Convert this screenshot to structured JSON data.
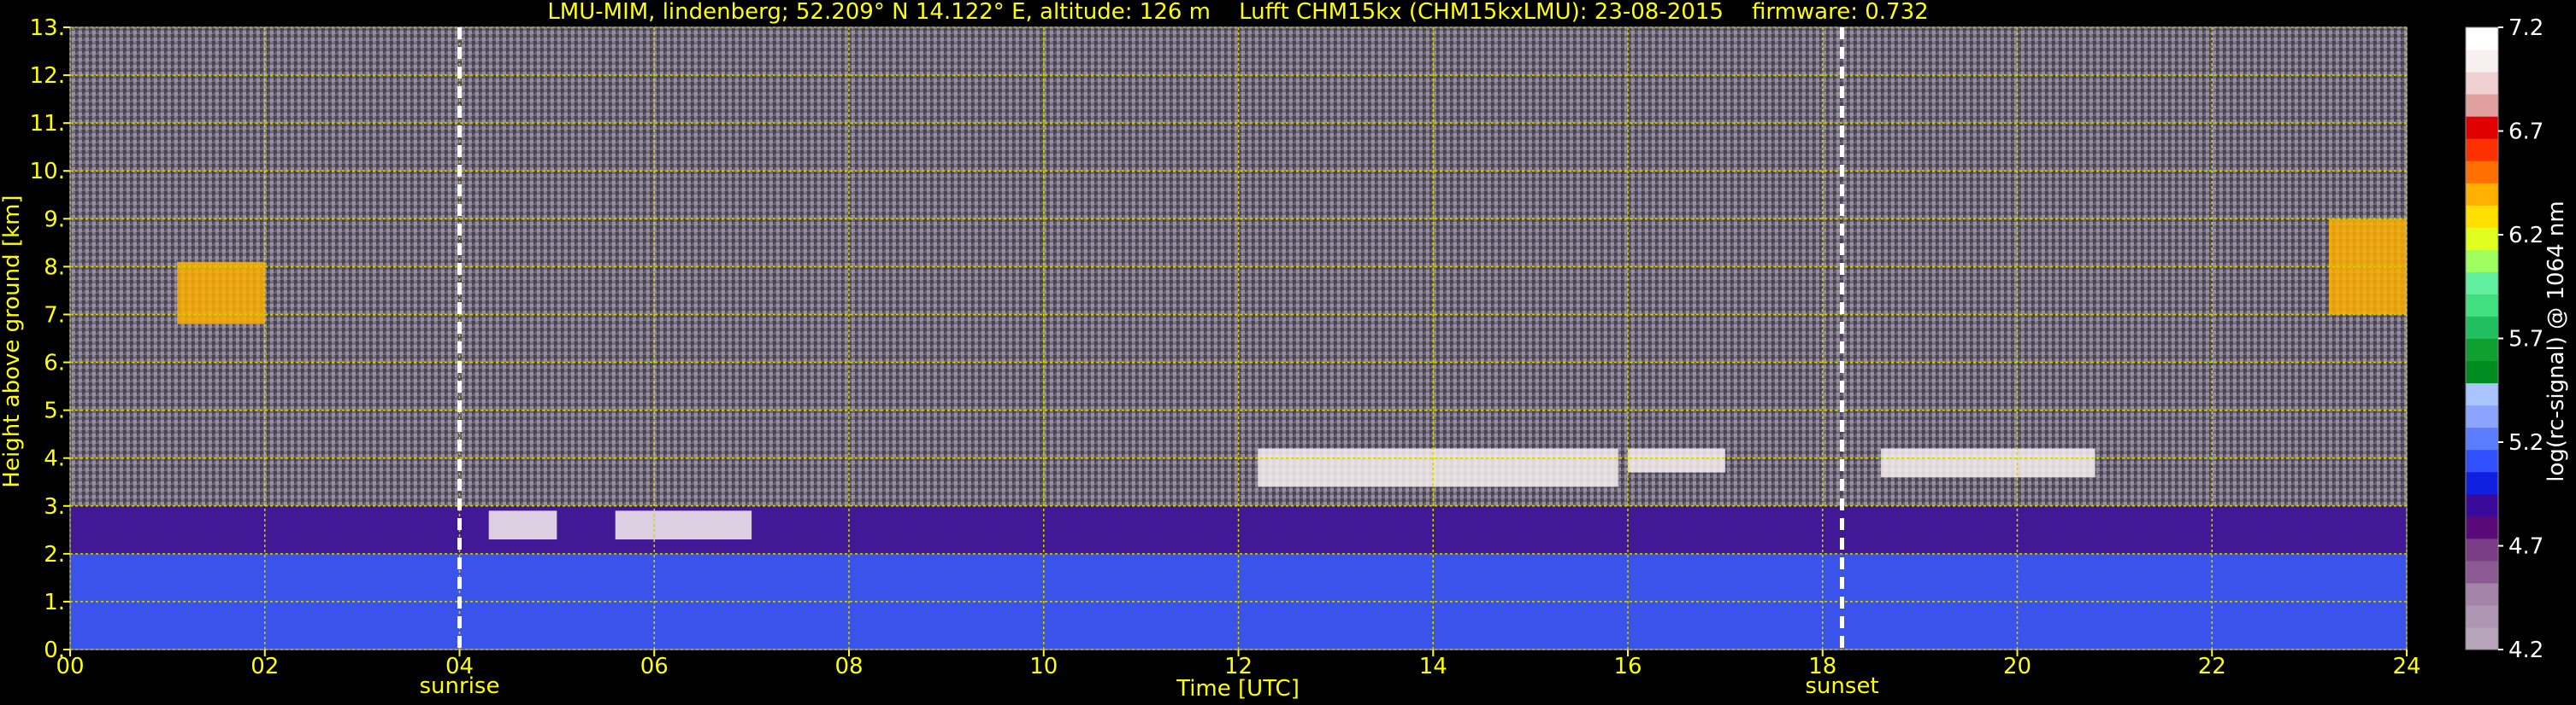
{
  "chart_data": {
    "type": "heatmap",
    "title": "LMU-MIM, lindenberg; 52.209° N 14.122° E, altitude: 126 m    Lufft CHM15kx (CHM15kxLMU): 23-08-2015    firmware: 0.732",
    "xlabel": "Time [UTC]",
    "ylabel": "Height above ground [km]",
    "xlim": [
      0,
      24
    ],
    "ylim": [
      0,
      13
    ],
    "x_ticks": [
      0,
      2,
      4,
      6,
      8,
      10,
      12,
      14,
      16,
      18,
      20,
      22,
      24
    ],
    "x_tick_labels": [
      "00",
      "02",
      "04",
      "06",
      "08",
      "10",
      "12",
      "14",
      "16",
      "18",
      "20",
      "22",
      "24"
    ],
    "y_ticks": [
      0,
      1,
      2,
      3,
      4,
      5,
      6,
      7,
      8,
      9,
      10,
      11,
      12,
      13
    ],
    "y_tick_labels": [
      "0.",
      "1.",
      "2.",
      "3.",
      "4.",
      "5.",
      "6.",
      "7.",
      "8.",
      "9.",
      "10.",
      "11.",
      "12.",
      "13."
    ],
    "grid": true,
    "grid_color": "#d4d400",
    "markers": [
      {
        "time": 4.0,
        "label": "sunrise"
      },
      {
        "time": 18.2,
        "label": "sunset"
      }
    ],
    "colorbar": {
      "label": "log(rc-signal) @ 1064 nm",
      "range": [
        4.2,
        7.2
      ],
      "ticks": [
        4.2,
        4.7,
        5.2,
        5.7,
        6.2,
        6.7,
        7.2
      ],
      "tick_labels": [
        "4.2",
        "4.7",
        "5.2",
        "5.7",
        "6.2",
        "6.7",
        "7.2"
      ],
      "colors": [
        "#b7a6bb",
        "#ad97b3",
        "#a484a8",
        "#8c5a92",
        "#7a3c84",
        "#5a0a78",
        "#3a0a9a",
        "#1020e0",
        "#3050ff",
        "#5a7cff",
        "#8aa4ff",
        "#aac4ff",
        "#008c20",
        "#10a030",
        "#20c060",
        "#40e080",
        "#60f0a0",
        "#a0ff60",
        "#e0ff20",
        "#ffe000",
        "#ffb000",
        "#ff7000",
        "#ff3000",
        "#e00000",
        "#e0a0a0",
        "#f0d0d0",
        "#f8f0f0",
        "#ffffff"
      ]
    },
    "layers": [
      {
        "name": "boundary layer",
        "t0": 0,
        "t1": 24,
        "h0": 0,
        "h1": 2.0,
        "level": 5.1
      },
      {
        "name": "residual layer",
        "t0": 0,
        "t1": 24,
        "h0": 2.0,
        "h1": 3.0,
        "level": 4.9
      },
      {
        "name": "cloud",
        "t0": 1.1,
        "t1": 2.0,
        "h0": 6.8,
        "h1": 8.1,
        "level": 6.4
      },
      {
        "name": "cloud",
        "t0": 4.3,
        "t1": 5.0,
        "h0": 2.3,
        "h1": 2.9,
        "level": 7.0
      },
      {
        "name": "cloud",
        "t0": 5.6,
        "t1": 7.0,
        "h0": 2.3,
        "h1": 2.9,
        "level": 7.0
      },
      {
        "name": "cloud",
        "t0": 12.2,
        "t1": 15.9,
        "h0": 3.4,
        "h1": 4.2,
        "level": 7.0
      },
      {
        "name": "cloud",
        "t0": 16.0,
        "t1": 17.0,
        "h0": 3.7,
        "h1": 4.2,
        "level": 7.0
      },
      {
        "name": "cloud",
        "t0": 18.6,
        "t1": 20.8,
        "h0": 3.6,
        "h1": 4.2,
        "level": 7.0
      },
      {
        "name": "cloud",
        "t0": 23.2,
        "t1": 24.0,
        "h0": 7.0,
        "h1": 9.0,
        "level": 6.4
      }
    ]
  }
}
